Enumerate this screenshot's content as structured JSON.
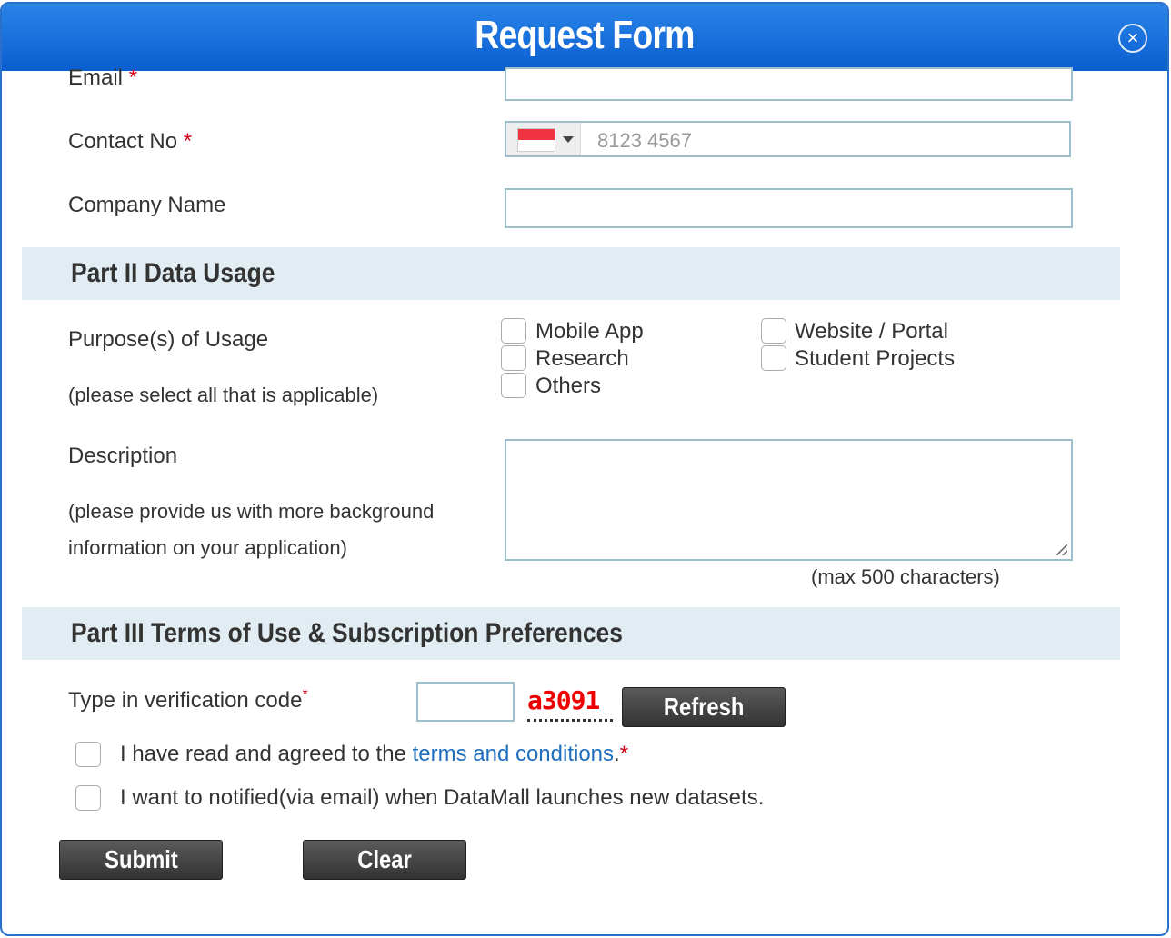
{
  "modal": {
    "title": "Request Form",
    "close_icon": "close-circle-icon"
  },
  "fields": {
    "email_label": "Email",
    "contact_label": "Contact No",
    "contact_placeholder": "8123 4567",
    "country_flag": "singapore-flag-icon",
    "company_label": "Company Name",
    "required_mark": "*"
  },
  "part2": {
    "title": "Part II Data Usage",
    "purpose_label": "Purpose(s) of Usage",
    "purpose_hint": "(please select all that is applicable)",
    "options": [
      "Mobile App",
      "Website / Portal",
      "Research",
      "Student Projects",
      "Others"
    ],
    "description_label": "Description",
    "description_hint1": "(please provide us with more background",
    "description_hint2": "information on your application)",
    "max_chars": "(max 500 characters)"
  },
  "part3": {
    "title": "Part III Terms of Use & Subscription Preferences",
    "verification_label": "Type in verification code",
    "captcha": "a3091",
    "refresh": "Refresh",
    "agree_prefix": "I have read and agreed to the ",
    "terms_link": "terms and conditions",
    "agree_suffix": ".",
    "notify": "I want to notified(via email) when DataMall launches new datasets."
  },
  "actions": {
    "submit": "Submit",
    "clear": "Clear"
  },
  "colors": {
    "header": "#1a6fdc",
    "section": "#e1ecf3",
    "required": "#d0021b",
    "link": "#1f6fc0"
  }
}
